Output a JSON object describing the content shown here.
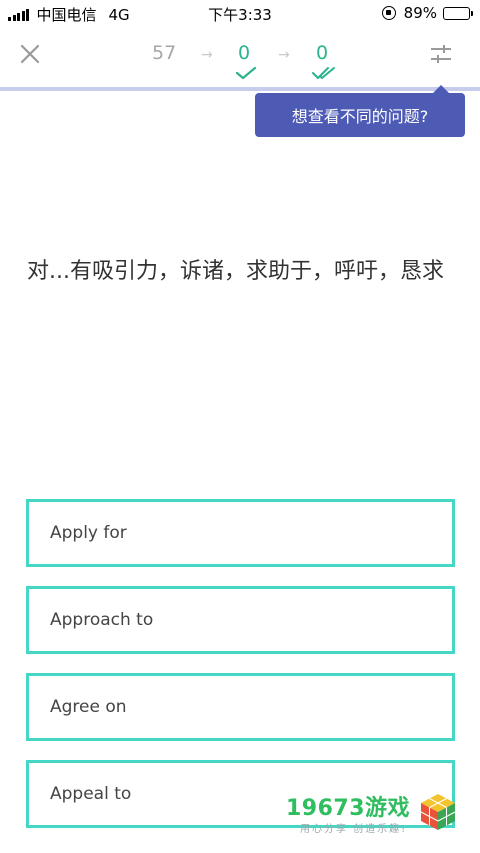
{
  "status_bar": {
    "carrier": "中国电信",
    "network": "4G",
    "time": "下午3:33",
    "battery_percent": "89%",
    "battery_level": 0.89
  },
  "header": {
    "remaining_count": "57",
    "first_pass_count": "0",
    "second_pass_count": "0",
    "icons": [
      "close-icon",
      "arrow-right-icon",
      "check-icon",
      "double-check-icon",
      "settings-sliders-icon"
    ]
  },
  "tooltip": {
    "text": "想查看不同的问题?"
  },
  "question": {
    "text": "对...有吸引力，诉诸，求助于，呼吁，恳求"
  },
  "answers": [
    {
      "label": "Apply for"
    },
    {
      "label": "Approach to"
    },
    {
      "label": "Agree on"
    },
    {
      "label": "Appeal to"
    }
  ],
  "watermark": {
    "title": "19673游戏",
    "subtitle": "用心分享 创造乐趣!"
  },
  "colors": {
    "accent_green": "#2ab48f",
    "answer_border": "#45d6c6",
    "tooltip_bg": "#4e5bb5",
    "progress_track": "#c7ccec"
  }
}
